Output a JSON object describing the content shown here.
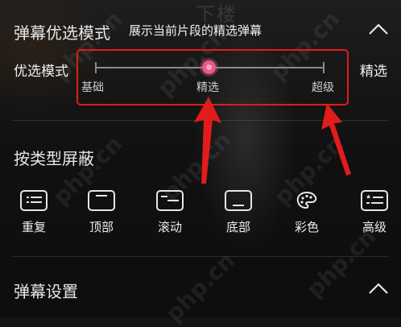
{
  "background_title": "下楼",
  "danmaku_mode_section": {
    "title": "弹幕优选模式",
    "description": "展示当前片段的精选弹幕",
    "left_label": "优选模式",
    "right_label": "精选",
    "slider": {
      "ticks": [
        "基础",
        "精选",
        "超级"
      ],
      "selected": "精选"
    }
  },
  "block_section": {
    "title": "按类型屏蔽",
    "items": [
      {
        "label": "重复",
        "icon": "repeat-danmaku-icon"
      },
      {
        "label": "顶部",
        "icon": "top-danmaku-icon"
      },
      {
        "label": "滚动",
        "icon": "scroll-danmaku-icon"
      },
      {
        "label": "底部",
        "icon": "bottom-danmaku-icon"
      },
      {
        "label": "彩色",
        "icon": "palette-icon"
      },
      {
        "label": "高级",
        "icon": "advanced-danmaku-icon"
      }
    ]
  },
  "settings_section": {
    "title": "弹幕设置"
  },
  "watermark": "php.cn",
  "colors": {
    "accent": "#e85a8a",
    "annotation": "#e21b1b"
  }
}
